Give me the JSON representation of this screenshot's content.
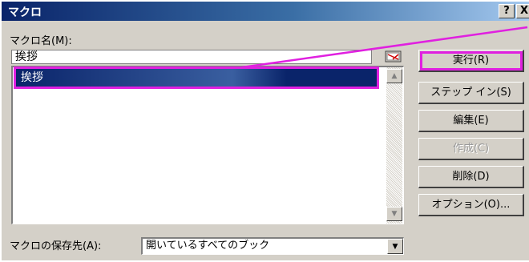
{
  "window": {
    "title": "マクロ",
    "help_label": "?",
    "close_label": "X"
  },
  "macro_name": {
    "label": "マクロ名(M):",
    "value": "挨拶"
  },
  "macro_list": {
    "items": [
      "挨拶"
    ],
    "selected_index": 0
  },
  "buttons": {
    "run": "実行(R)",
    "step_into": "ステップ イン(S)",
    "edit": "編集(E)",
    "create": "作成(C)",
    "delete": "削除(D)",
    "options": "オプション(O)..."
  },
  "save_location": {
    "label": "マクロの保存先(A):",
    "value": "開いているすべてのブック"
  },
  "colors": {
    "highlight": "#e020e0",
    "title_bar": "#0a246a",
    "selection": "#0a246a"
  }
}
